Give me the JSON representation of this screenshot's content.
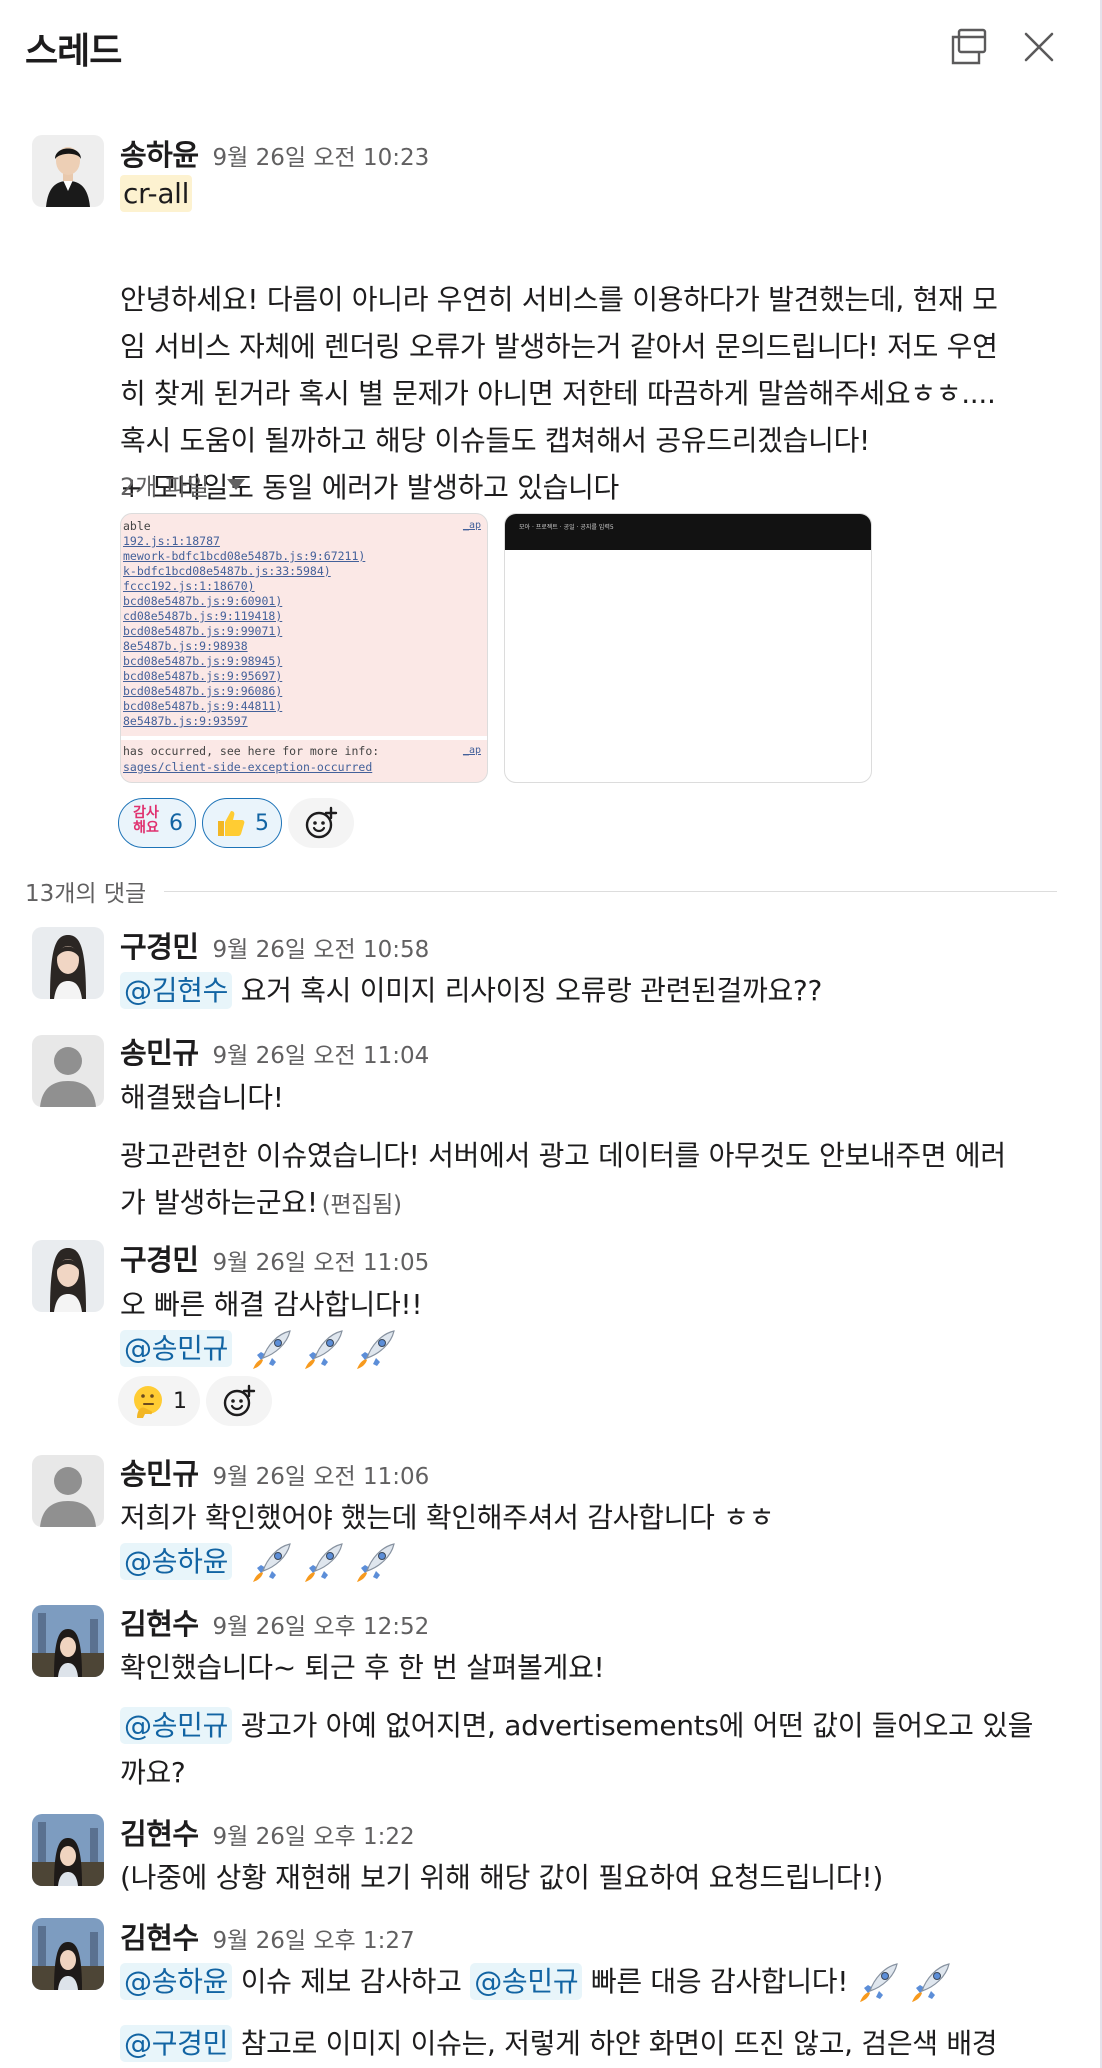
{
  "header": {
    "title": "스레드",
    "popout_icon": "new-window-icon",
    "close_icon": "close-icon"
  },
  "root": {
    "author": "송하윤",
    "time": "9월 26일 오전 10:23",
    "tag": "cr-all",
    "body": [
      "안녕하세요! 다름이 아니라 우연히 서비스를 이용하다가 발견했는데, 현재 모",
      "임 서비스 자체에 렌더링 오류가 발생하는거 같아서 문의드립니다! 저도 우연",
      "히 찾게 된거라 혹시 별 문제가 아니면 저한테 따끔하게 말씀해주세요ㅎㅎ....",
      "혹시 도움이 될까하고 해당 이슈들도 캡쳐해서 공유드리겠습니다!",
      "+ 모바일도 동일 에러가 발생하고 있습니다"
    ],
    "files_label": "2개 파일",
    "error_screenshot": {
      "lines": [
        "able",
        "192.js:1:18787",
        "mework-bdfc1bcd08e5487b.js:9:67211)",
        "k-bdfc1bcd08e5487b.js:33:5984)",
        "fccc192.js:1:18670)",
        "bcd08e5487b.js:9:60901)",
        "cd08e5487b.js:9:119418)",
        "bcd08e5487b.js:9:99071)",
        "8e5487b.js:9:98938",
        "bcd08e5487b.js:9:98945)",
        "bcd08e5487b.js:9:95697)",
        "bcd08e5487b.js:9:96086)",
        "bcd08e5487b.js:9:44811)",
        "8e5487b.js:9:93597"
      ],
      "tag": "_ap",
      "footer_1": "has occurred, see here for more info:",
      "footer_2": "sages/client-side-exception-occurred"
    },
    "blank_screenshot": {
      "nav": "모아 · 프로젝트 · 공일 · 공지를 입력5"
    },
    "reactions": [
      {
        "emoji": "kamsa",
        "emoji_text": "감사\n해요",
        "count": "6"
      },
      {
        "emoji": "thumbs-up",
        "count": "5"
      }
    ]
  },
  "reply_count": "13개의 댓글",
  "replies": [
    {
      "author": "구경민",
      "time": "9월 26일 오전 10:58",
      "mention": "@김현수",
      "text": "요거 혹시 이미지 리사이징 오류랑 관련된걸까요??"
    },
    {
      "author": "송민규",
      "time": "9월 26일 오전 11:04",
      "line1": "해결됐습니다!",
      "line2": "광고관련한 이슈였습니다! 서버에서 광고 데이터를 아무것도 안보내주면 에러",
      "line3": "가 발생하는군요!",
      "edited": "(편집됨)"
    },
    {
      "author": "구경민",
      "time": "9월 26일 오전 11:05",
      "line1": "오 빠른 해결 감사합니다!!",
      "mention": "@송민규",
      "reaction_count": "1"
    },
    {
      "author": "송민규",
      "time": "9월 26일 오전 11:06",
      "line1": "저희가 확인했어야 했는데 확인해주셔서 감사합니다 ㅎㅎ",
      "mention": "@송하윤"
    },
    {
      "author": "김현수",
      "time": "9월 26일 오후 12:52",
      "line1": "확인했습니다~ 퇴근 후 한 번 살펴볼게요!",
      "mention": "@송민규",
      "line2": "광고가 아예 없어지면, advertisements에 어떤 값이 들어오고 있을",
      "line3": "까요?"
    },
    {
      "author": "김현수",
      "time": "9월 26일 오후 1:22",
      "line1": "(나중에 상황 재현해 보기 위해 해당 값이 필요하여 요청드립니다!)"
    },
    {
      "author": "김현수",
      "time": "9월 26일 오후 1:27",
      "mention_a": "@송하윤",
      "text_a": "이슈 제보 감사하고",
      "mention_b": "@송민규",
      "text_b": "빠른 대응 감사합니다!",
      "mention_c": "@구경민",
      "text_c": "참고로 이미지 이슈는, 저렇게 하얀 화면이 뜨진 않고, 검은색 배경"
    }
  ]
}
